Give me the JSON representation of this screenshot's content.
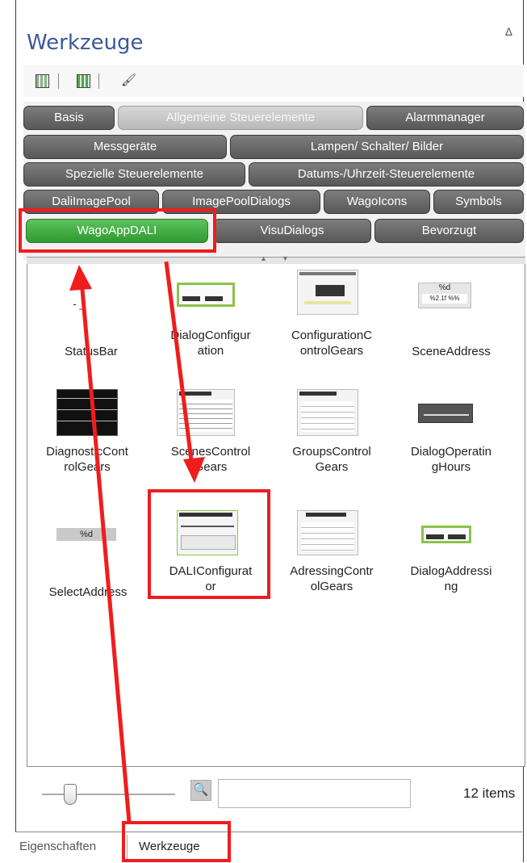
{
  "panel": {
    "title": "Werkzeuge",
    "pin_glyph": "ⵠ",
    "toolbar": {
      "icons": [
        "grid-view-icon",
        "grid-view-selected-icon",
        "brush-icon"
      ],
      "brush_glyph": "🖌"
    }
  },
  "tabs": [
    {
      "label": "Basis",
      "style": "dark"
    },
    {
      "label": "Allgemeine Steuerelemente",
      "style": "light"
    },
    {
      "label": "Alarmmanager",
      "style": "dark"
    },
    {
      "label": "Messgeräte",
      "style": "dark"
    },
    {
      "label": "Lampen/ Schalter/ Bilder",
      "style": "dark"
    },
    {
      "label": "Spezielle Steuerelemente",
      "style": "dark"
    },
    {
      "label": "Datums-/Uhrzeit-Steuerelemente",
      "style": "dark"
    },
    {
      "label": "DaliImagePool",
      "style": "dark"
    },
    {
      "label": "ImagePoolDialogs",
      "style": "dark"
    },
    {
      "label": "WagoIcons",
      "style": "dark"
    },
    {
      "label": "Symbols",
      "style": "dark"
    },
    {
      "label": "WagoAppDALI",
      "style": "active"
    },
    {
      "label": "VisuDialogs",
      "style": "dark"
    },
    {
      "label": "Bevorzugt",
      "style": "dark"
    }
  ],
  "items": [
    {
      "name": "StatusBar",
      "lines": [
        "StatusBar"
      ],
      "icon": "status-bar-icon",
      "thumb_text": "-  _"
    },
    {
      "name": "DialogConfiguration",
      "lines": [
        "DialogConfigur",
        "ation"
      ],
      "icon": "dialog-configuration-icon"
    },
    {
      "name": "ConfigurationControlGears",
      "lines": [
        "ConfigurationC",
        "ontrolGears"
      ],
      "icon": "configuration-control-gears-icon"
    },
    {
      "name": "SceneAddress",
      "lines": [
        "SceneAddress"
      ],
      "icon": "scene-address-icon",
      "thumb_text": "%d",
      "thumb_subtext": "%2.1f %%"
    },
    {
      "name": "DiagnosticControlGears",
      "lines": [
        "DiagnosticCont",
        "rolGears"
      ],
      "icon": "diagnostic-control-gears-icon"
    },
    {
      "name": "ScenesControlGears",
      "lines": [
        "ScenesControl",
        "Gears"
      ],
      "icon": "scenes-control-gears-icon"
    },
    {
      "name": "GroupsControlGears",
      "lines": [
        "GroupsControl",
        "Gears"
      ],
      "icon": "groups-control-gears-icon"
    },
    {
      "name": "DialogOperatingHours",
      "lines": [
        "DialogOperatin",
        "gHours"
      ],
      "icon": "dialog-operating-hours-icon"
    },
    {
      "name": "SelectAddress",
      "lines": [
        "SelectAddress"
      ],
      "icon": "select-address-icon",
      "thumb_text": "%d"
    },
    {
      "name": "DALIConfigurator",
      "lines": [
        "DALIConfigurat",
        "or"
      ],
      "icon": "dali-configurator-icon"
    },
    {
      "name": "AdressingControlGears",
      "lines": [
        "AdressingContr",
        "olGears"
      ],
      "icon": "adressing-control-gears-icon"
    },
    {
      "name": "DialogAddressing",
      "lines": [
        "DialogAddressi",
        "ng"
      ],
      "icon": "dialog-addressing-icon"
    }
  ],
  "footer": {
    "search_placeholder": "",
    "search_glyph": "🔍",
    "items_count": "12 items",
    "zoom_level": 0.2
  },
  "bottom_tabs": [
    {
      "label": "Eigenschaften",
      "selected": false
    },
    {
      "label": "Werkzeuge",
      "selected": true
    }
  ],
  "colors": {
    "title": "#3b5998",
    "tab_dark": "#6b6b6b",
    "tab_active": "#3aa63a",
    "annotation_red": "#ef1d1d"
  }
}
